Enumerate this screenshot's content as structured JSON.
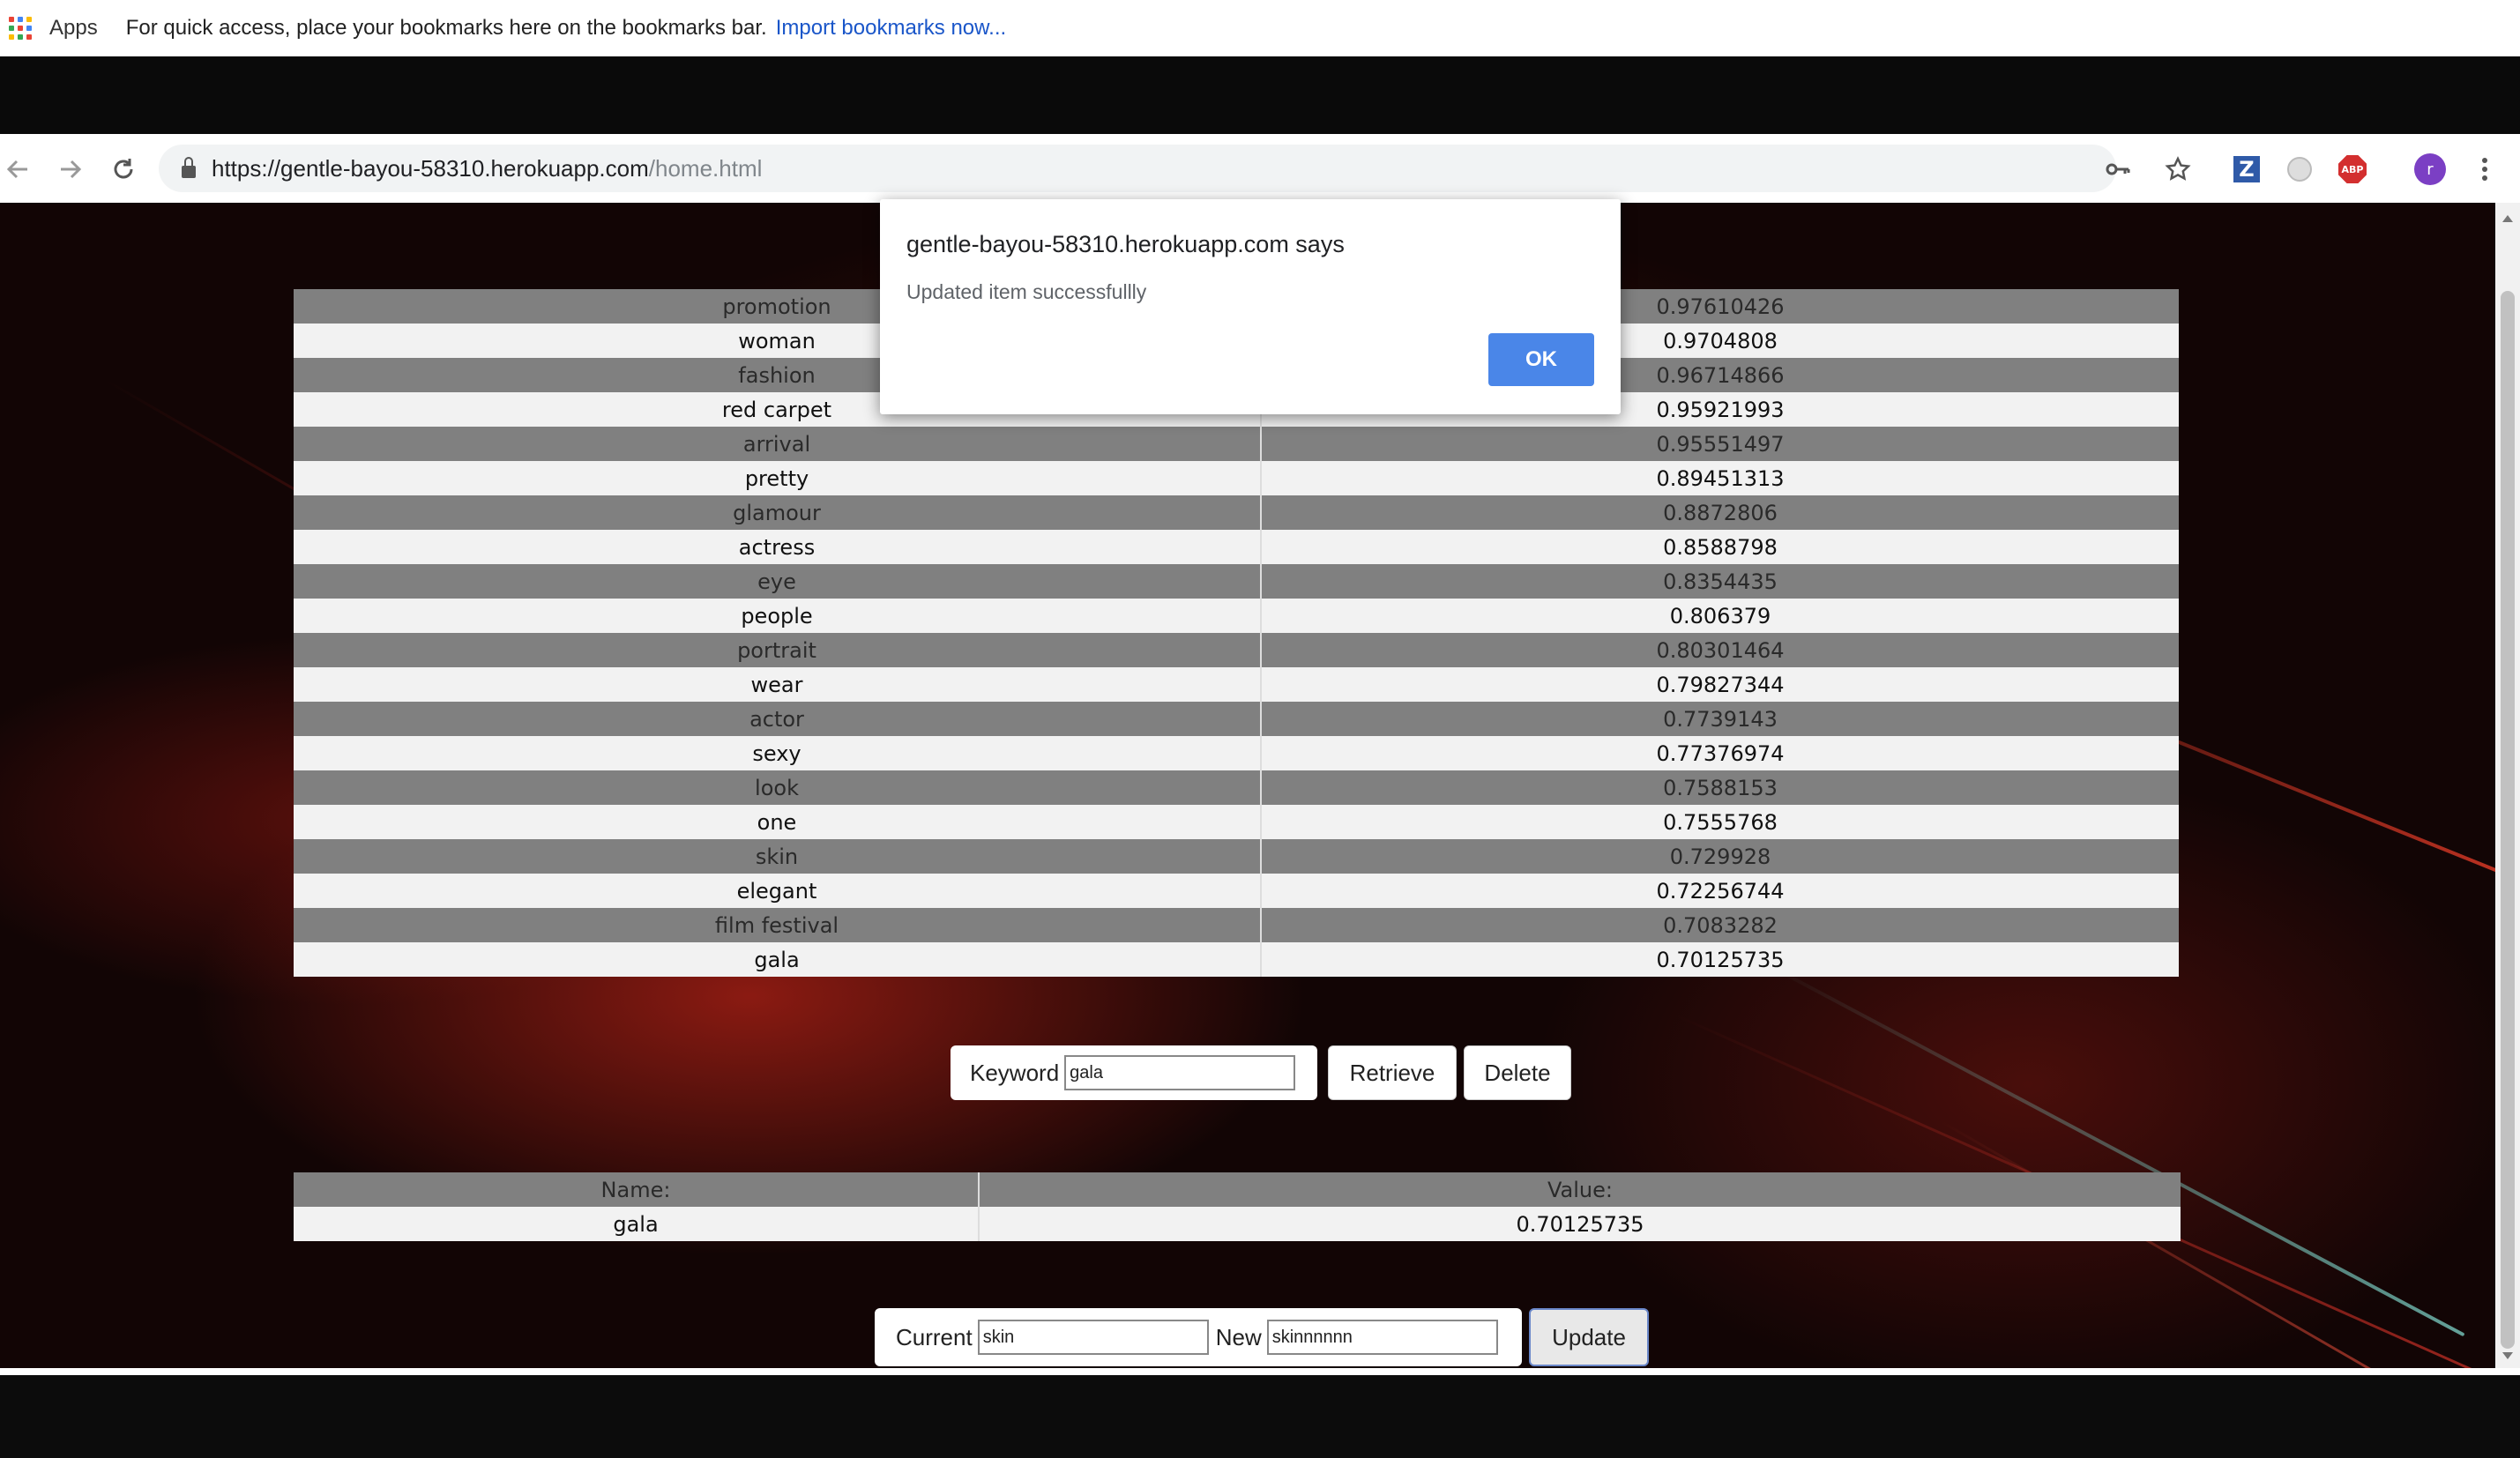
{
  "bookmarks_bar": {
    "apps_label": "Apps",
    "note": "For quick access, place your bookmarks here on the bookmarks bar.",
    "import_link": "Import bookmarks now..."
  },
  "omnibox": {
    "url_host": "https://gentle-bayou-58310.herokuapp.com",
    "url_path": "/home.html"
  },
  "extensions": {
    "z_label": "Z",
    "abp_label": "ABP",
    "avatar_initial": "r"
  },
  "keywords": [
    {
      "name": "promotion",
      "value": "0.97610426"
    },
    {
      "name": "woman",
      "value": "0.9704808"
    },
    {
      "name": "fashion",
      "value": "0.96714866"
    },
    {
      "name": "red carpet",
      "value": "0.95921993"
    },
    {
      "name": "arrival",
      "value": "0.95551497"
    },
    {
      "name": "pretty",
      "value": "0.89451313"
    },
    {
      "name": "glamour",
      "value": "0.8872806"
    },
    {
      "name": "actress",
      "value": "0.8588798"
    },
    {
      "name": "eye",
      "value": "0.8354435"
    },
    {
      "name": "people",
      "value": "0.806379"
    },
    {
      "name": "portrait",
      "value": "0.80301464"
    },
    {
      "name": "wear",
      "value": "0.79827344"
    },
    {
      "name": "actor",
      "value": "0.7739143"
    },
    {
      "name": "sexy",
      "value": "0.77376974"
    },
    {
      "name": "look",
      "value": "0.7588153"
    },
    {
      "name": "one",
      "value": "0.7555768"
    },
    {
      "name": "skin",
      "value": "0.729928"
    },
    {
      "name": "elegant",
      "value": "0.72256744"
    },
    {
      "name": "film festival",
      "value": "0.7083282"
    },
    {
      "name": "gala",
      "value": "0.70125735"
    }
  ],
  "keyword_form": {
    "label": "Keyword",
    "value": "gala",
    "retrieve_label": "Retrieve",
    "delete_label": "Delete"
  },
  "result_table": {
    "name_header": "Name:",
    "value_header": "Value:",
    "name": "gala",
    "value": "0.70125735"
  },
  "update_form": {
    "current_label": "Current",
    "current_value": "skin",
    "new_label": "New",
    "new_value": "skinnnnnn",
    "update_label": "Update"
  },
  "dialog": {
    "title": "gentle-bayou-58310.herokuapp.com says",
    "message": "Updated item successfullly",
    "ok_label": "OK",
    "ok_color": "#4a86e8"
  }
}
